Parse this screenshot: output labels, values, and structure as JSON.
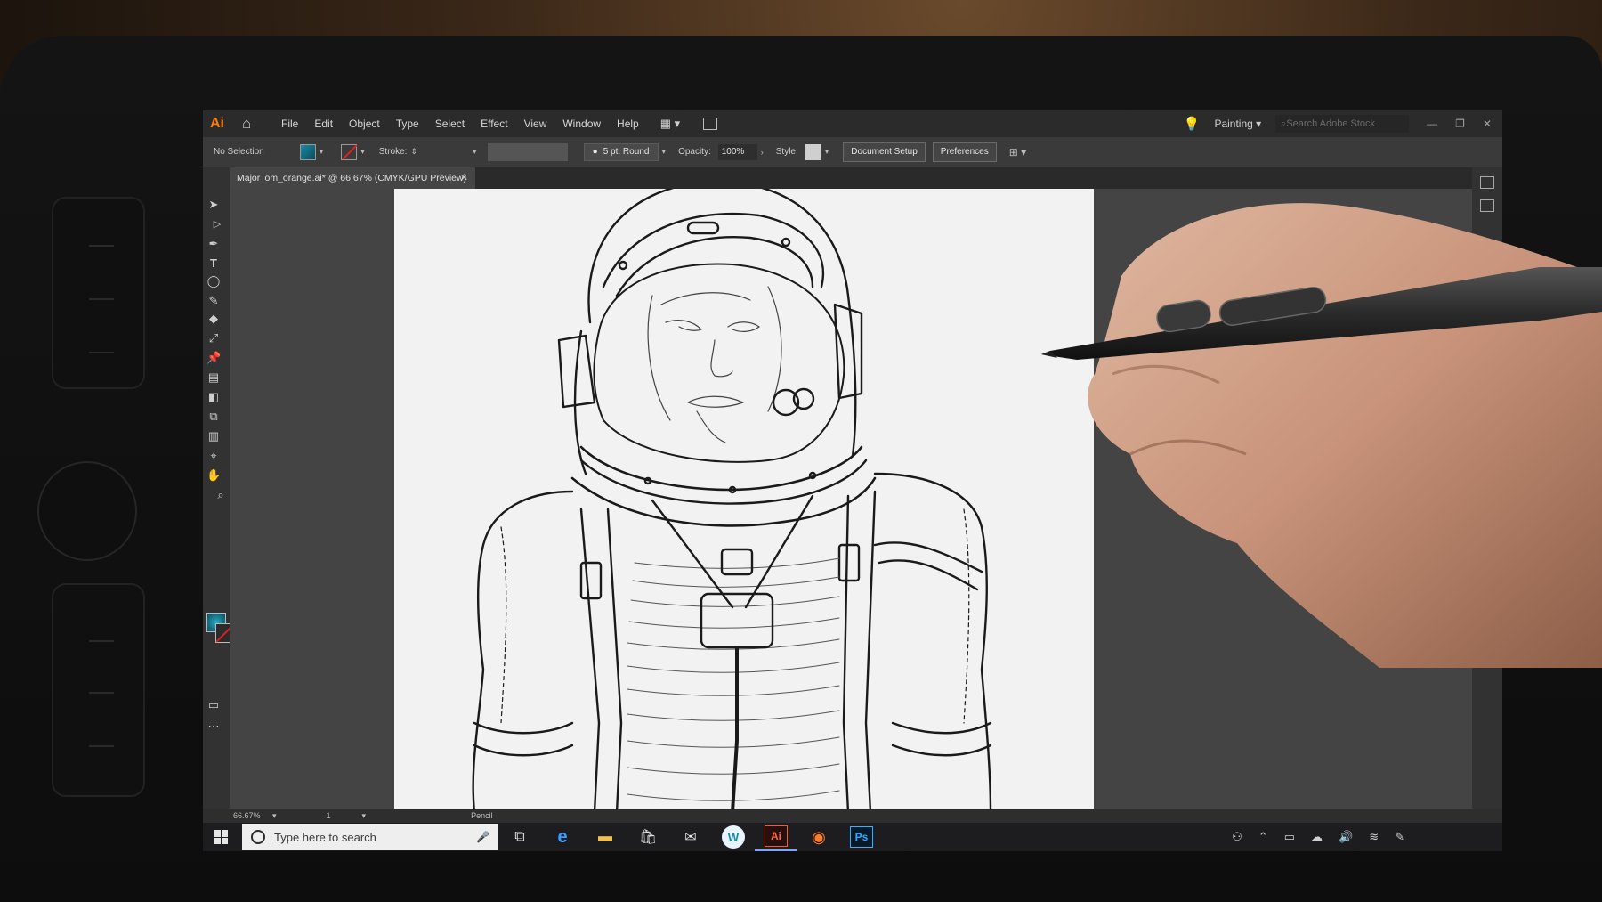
{
  "app": {
    "logo": "Ai",
    "document_tab": "MajorTom_orange.ai* @ 66.67% (CMYK/GPU Preview)"
  },
  "menu": [
    "File",
    "Edit",
    "Object",
    "Type",
    "Select",
    "Effect",
    "View",
    "Window",
    "Help"
  ],
  "header_right": {
    "workspace": "Painting",
    "search_placeholder": "Search Adobe Stock"
  },
  "control_bar": {
    "selection": "No Selection",
    "stroke_label": "Stroke:",
    "brush": "5 pt. Round",
    "opacity_label": "Opacity:",
    "opacity_value": "100%",
    "style_label": "Style:",
    "document_setup": "Document Setup",
    "preferences": "Preferences"
  },
  "status_bar": {
    "zoom": "66.67%",
    "artboard": "1",
    "tool": "Pencil"
  },
  "taskbar": {
    "search_placeholder": "Type here to search"
  },
  "colors": {
    "fill": "#1a8aa3",
    "stroke_none": "#e02020",
    "ai_orange": "#ff7c00"
  },
  "icons": [
    "home-icon",
    "lightbulb-icon",
    "search-icon",
    "selection-tool-icon",
    "pen-tool-icon",
    "type-tool-icon",
    "pencil-tool-icon",
    "hand-tool-icon",
    "zoom-tool-icon",
    "windows-start-icon",
    "microphone-icon",
    "edge-icon",
    "file-explorer-icon",
    "store-icon",
    "mail-icon",
    "firefox-icon",
    "photoshop-icon",
    "illustrator-icon"
  ]
}
